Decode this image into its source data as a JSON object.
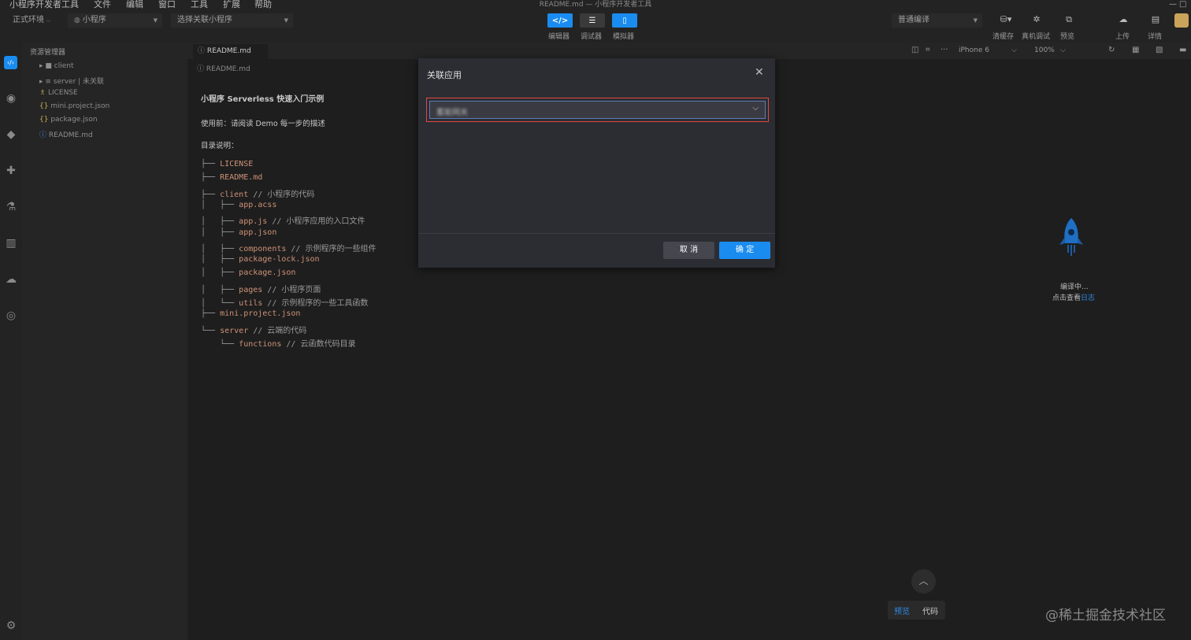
{
  "menubar": {
    "items": [
      "小程序开发者工具",
      "文件",
      "编辑",
      "窗口",
      "工具",
      "扩展",
      "帮助"
    ],
    "window_title": "README.md — 小程序开发者工具"
  },
  "toolbar": {
    "env_select": "正式环境",
    "project_type_select": "小程序",
    "linked_app_select": "选择关联小程序",
    "view_buttons": [
      "编辑器",
      "调试器",
      "模拟器"
    ],
    "compile_mode_select": "普通编译",
    "actions": [
      "清缓存",
      "真机调试",
      "预览",
      "上传",
      "详情"
    ]
  },
  "explorer": {
    "title": "资源管理器",
    "items": [
      {
        "label": "client",
        "type": "folder"
      },
      {
        "label": "server | 未关联",
        "type": "folder"
      },
      {
        "label": "LICENSE",
        "type": "file"
      },
      {
        "label": "mini.project.json",
        "type": "json"
      },
      {
        "label": "package.json",
        "type": "json"
      },
      {
        "label": "README.md",
        "type": "info"
      }
    ]
  },
  "editor": {
    "tab_label": "README.md",
    "breadcrumb": "README.md",
    "heading": "小程序 Serverless 快速入门示例",
    "intro": "使用前：请阅读 Demo 每一步的描述",
    "dir_title": "目录说明：",
    "tree_lines": [
      {
        "prefix": "├── ",
        "name": "LICENSE",
        "comment": ""
      },
      {
        "prefix": "├── ",
        "name": "README.md",
        "comment": ""
      },
      {
        "prefix": "├── ",
        "name": "client",
        "comment": " // 小程序的代码"
      },
      {
        "prefix": "│   ├── ",
        "name": "app.acss",
        "comment": ""
      },
      {
        "prefix": "│   ├── ",
        "name": "app.js",
        "comment": " // 小程序应用的入口文件"
      },
      {
        "prefix": "│   ├── ",
        "name": "app.json",
        "comment": ""
      },
      {
        "prefix": "│   ├── ",
        "name": "components",
        "comment": " // 示例程序的一些组件"
      },
      {
        "prefix": "│   ├── ",
        "name": "package-lock.json",
        "comment": ""
      },
      {
        "prefix": "│   ├── ",
        "name": "package.json",
        "comment": ""
      },
      {
        "prefix": "│   ├── ",
        "name": "pages",
        "comment": " // 小程序页面"
      },
      {
        "prefix": "│   └── ",
        "name": "utils",
        "comment": " // 示例程序的一些工具函数"
      },
      {
        "prefix": "├── ",
        "name": "mini.project.json",
        "comment": ""
      },
      {
        "prefix": "└── ",
        "name": "server",
        "comment": " // 云端的代码"
      },
      {
        "prefix": "    └── ",
        "name": "functions",
        "comment": " // 云函数代码目录"
      }
    ]
  },
  "simulator": {
    "device_select": "iPhone 6",
    "zoom_select": "100%",
    "status": "编译中...",
    "log_prefix": "点击查看",
    "log_link": "日志",
    "bottom_tabs": [
      "预览",
      "代码"
    ]
  },
  "dialog": {
    "title": "关联应用",
    "select_value": "蓄能网关",
    "cancel_label": "取 消",
    "ok_label": "确 定"
  },
  "watermark": "@稀土掘金技术社区",
  "colors": {
    "accent": "#1a8cf0",
    "highlight_border": "#e0473d",
    "code_string": "#ce9178"
  }
}
